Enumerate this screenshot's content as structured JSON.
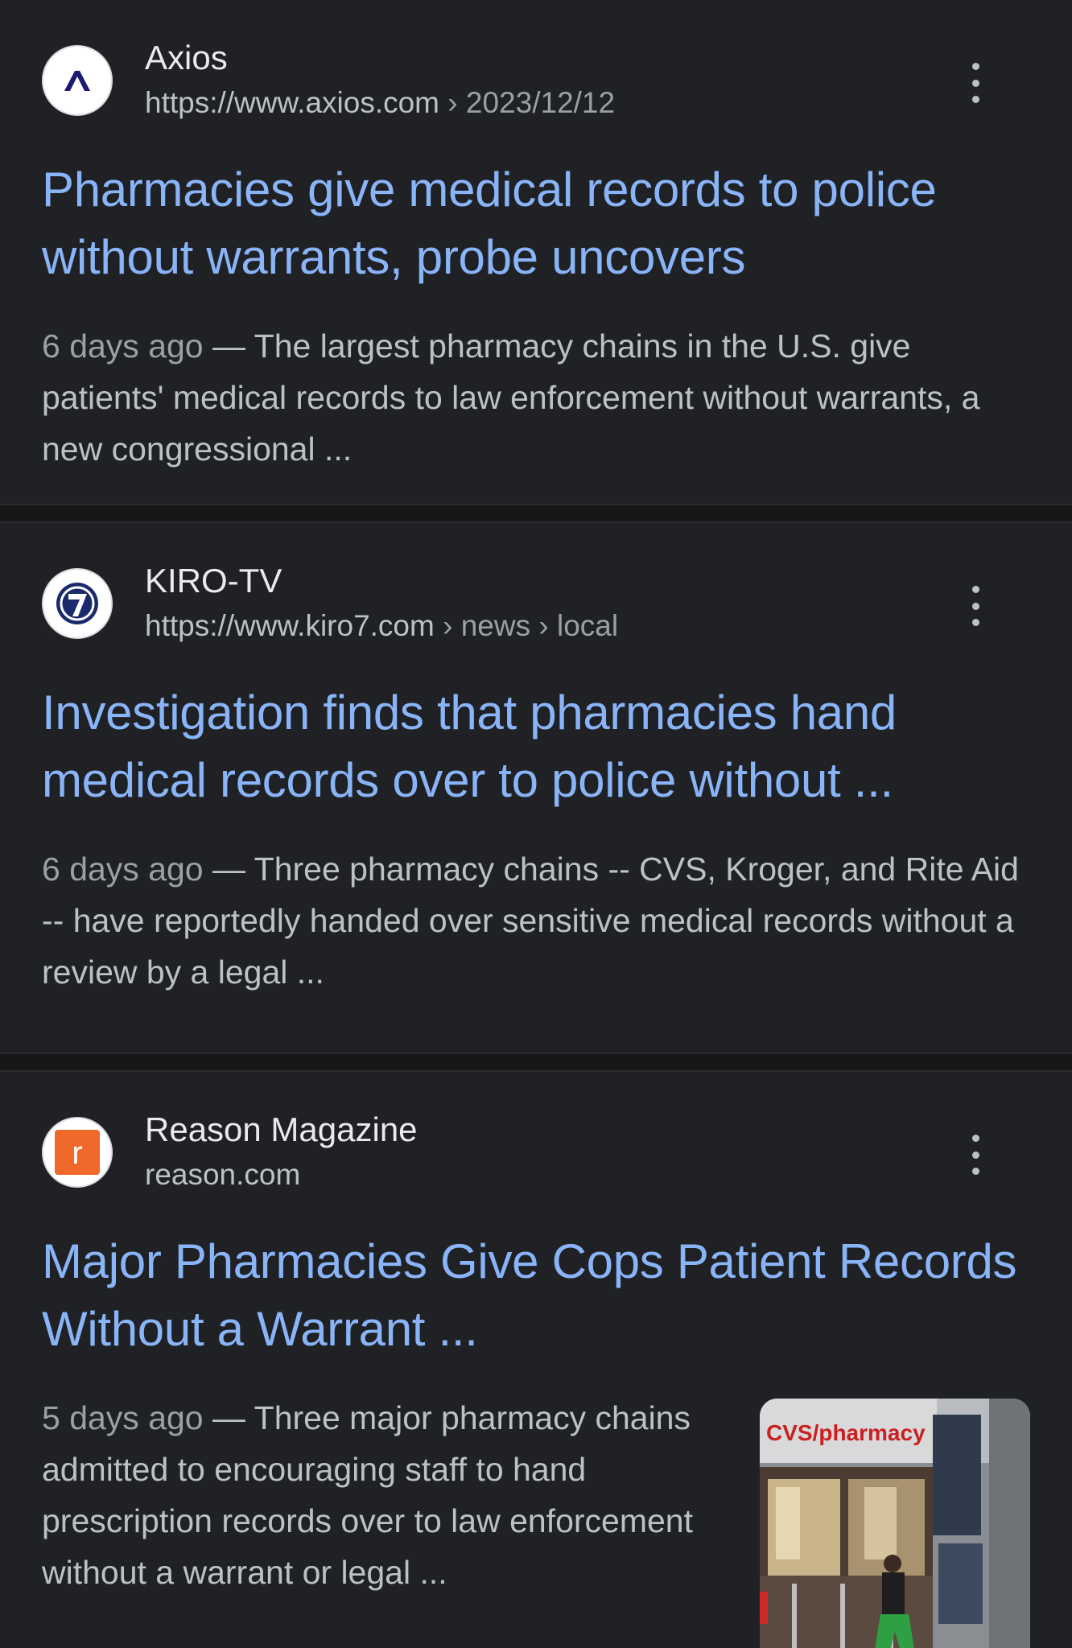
{
  "results": [
    {
      "source": "Axios",
      "url_base": "https://www.axios.com",
      "url_path": " › 2023/12/12",
      "title": "Pharmacies give medical records to police without warrants, probe uncovers",
      "date": "6 days ago",
      "snippet": " — The largest pharmacy chains in the U.S. give patients' medical records to law enforcement without warrants, a new congressional ..."
    },
    {
      "source": "KIRO-TV",
      "url_base": "https://www.kiro7.com",
      "url_path": " › news › local",
      "title": "Investigation finds that pharmacies hand medical records over to police without ...",
      "date": "6 days ago",
      "snippet": " — Three pharmacy chains -- CVS, Kroger, and Rite Aid -- have reportedly handed over sensitive medical records without a review by a legal ..."
    },
    {
      "source": "Reason Magazine",
      "url_base": "reason.com",
      "url_path": "",
      "title": "Major Pharmacies Give Cops Patient Records Without a Warrant ...",
      "date": "5 days ago",
      "snippet": " — Three major pharmacy chains admitted to encouraging staff to hand prescription records over to law enforcement without a warrant or legal ...",
      "thumbnail_sign": "CVS/pharmacy"
    }
  ],
  "icons": {
    "axios": "axios-logo-icon",
    "kiro": "kiro7-logo-icon",
    "reason": "reason-logo-icon",
    "more": "more-vert-icon"
  },
  "colors": {
    "background": "#202124",
    "title_link": "#8ab4f8",
    "reason_orange": "#f0692b"
  }
}
